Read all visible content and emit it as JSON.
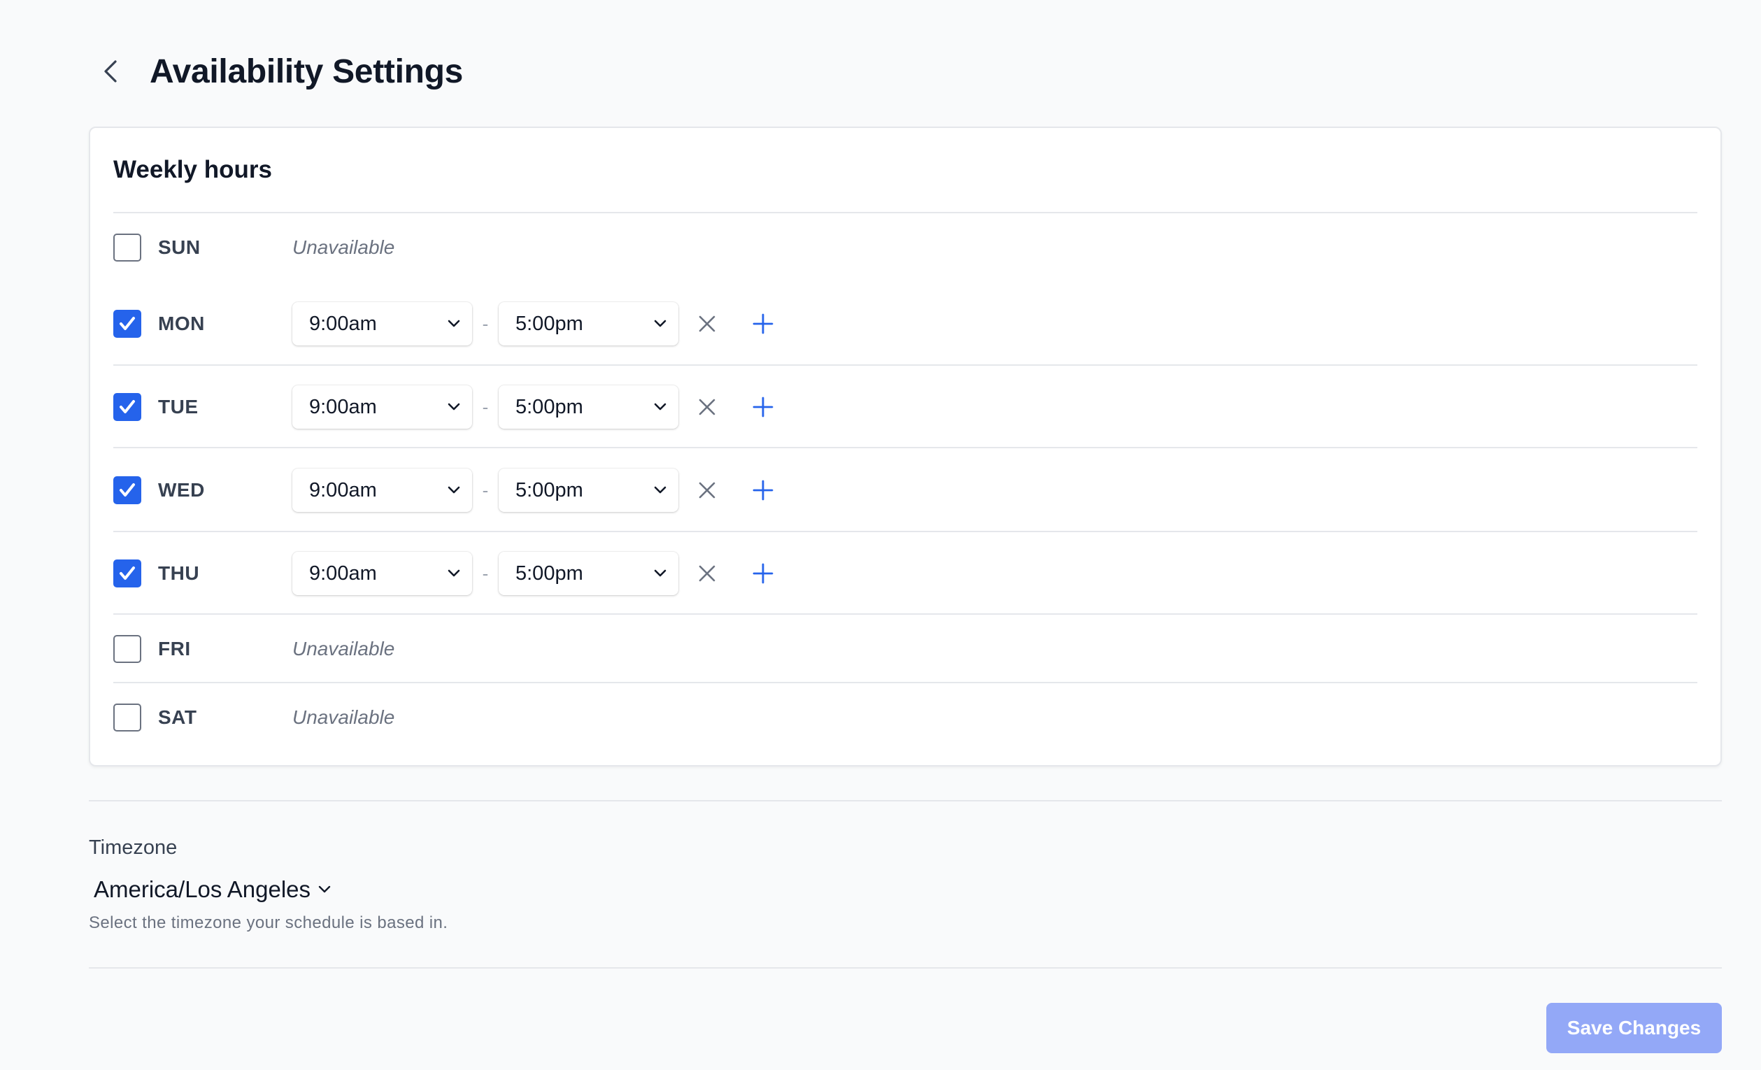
{
  "header": {
    "title": "Availability Settings",
    "back_icon": "chevron-left-icon"
  },
  "weekly_hours": {
    "title": "Weekly hours",
    "unavailable_text": "Unavailable",
    "range_separator": "-",
    "days": [
      {
        "label": "SUN",
        "checked": false
      },
      {
        "label": "MON",
        "checked": true,
        "start": "9:00am",
        "end": "5:00pm"
      },
      {
        "label": "TUE",
        "checked": true,
        "start": "9:00am",
        "end": "5:00pm"
      },
      {
        "label": "WED",
        "checked": true,
        "start": "9:00am",
        "end": "5:00pm"
      },
      {
        "label": "THU",
        "checked": true,
        "start": "9:00am",
        "end": "5:00pm"
      },
      {
        "label": "FRI",
        "checked": false
      },
      {
        "label": "SAT",
        "checked": false
      }
    ]
  },
  "timezone": {
    "label": "Timezone",
    "value": "America/Los Angeles",
    "help": "Select the timezone your schedule is based in."
  },
  "save_button": {
    "label": "Save Changes"
  },
  "colors": {
    "accent": "#2563eb",
    "save_disabled": "#93a8f7",
    "background": "#f9fafb"
  }
}
